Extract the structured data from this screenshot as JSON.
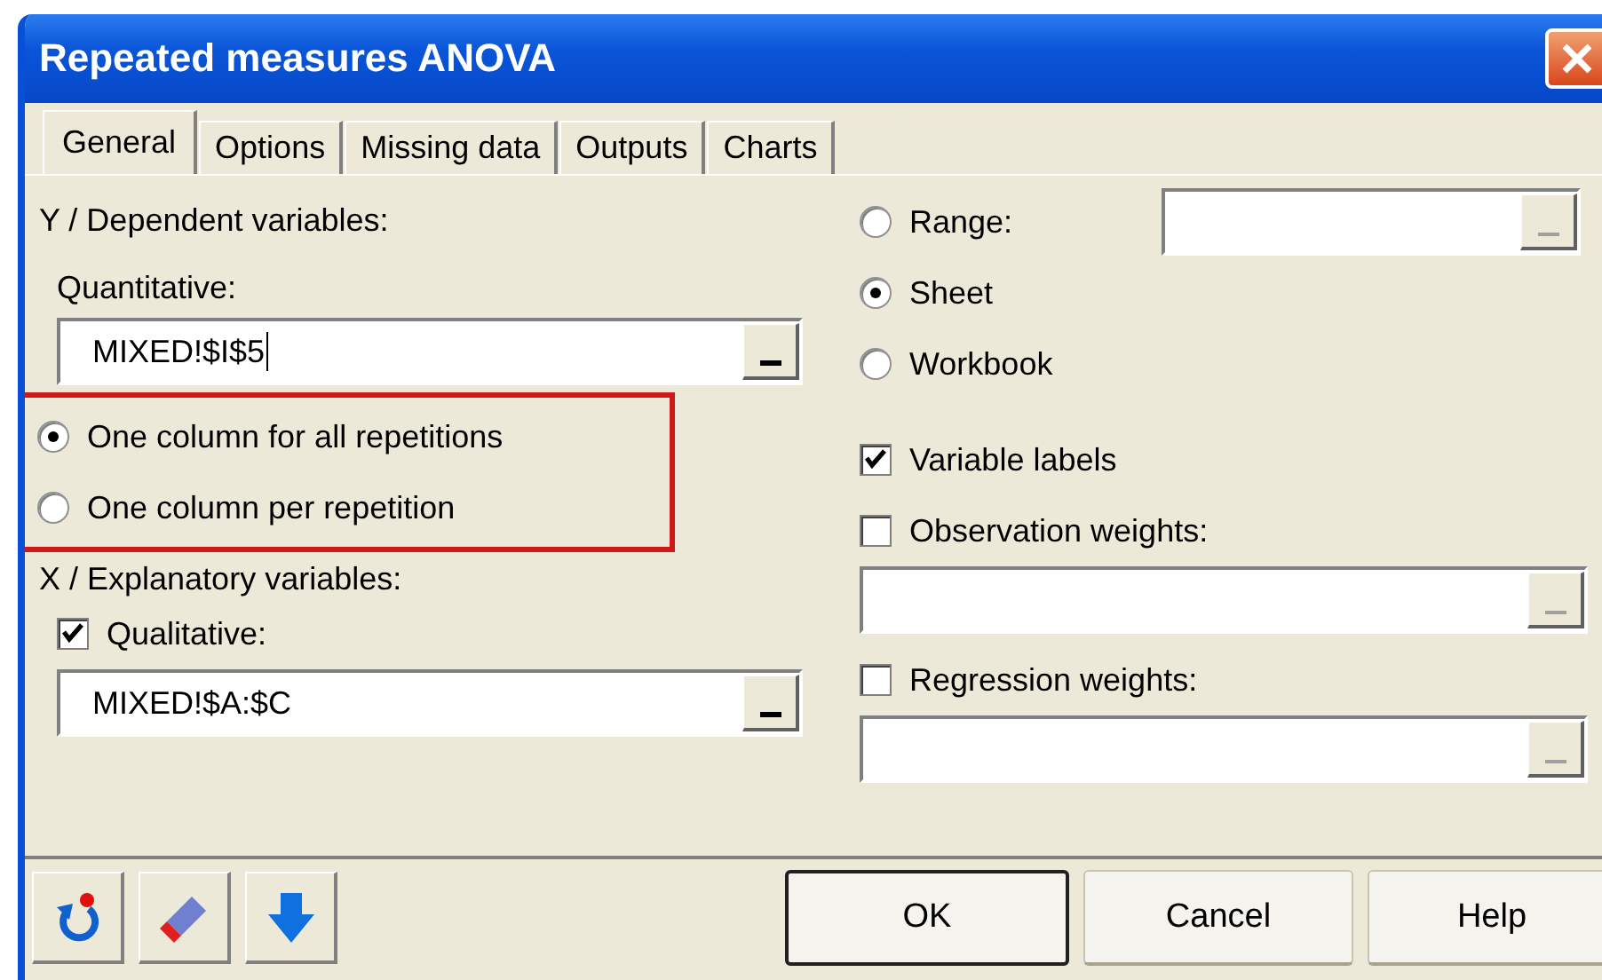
{
  "window": {
    "title": "Repeated measures ANOVA"
  },
  "tabs": [
    {
      "label": "General",
      "selected": true
    },
    {
      "label": "Options",
      "selected": false
    },
    {
      "label": "Missing data",
      "selected": false
    },
    {
      "label": "Outputs",
      "selected": false
    },
    {
      "label": "Charts",
      "selected": false
    }
  ],
  "dependent": {
    "heading": "Y / Dependent variables:",
    "label": "Quantitative:",
    "field": {
      "value": "MIXED!$I$5",
      "focused": true
    }
  },
  "repetition_layout": {
    "highlighted": true,
    "options": [
      {
        "label": "One column for all repetitions",
        "selected": true
      },
      {
        "label": "One column per repetition",
        "selected": false
      }
    ]
  },
  "explanatory": {
    "heading": "X / Explanatory variables:",
    "qualitative": {
      "label": "Qualitative:",
      "checked": true
    },
    "field": {
      "value": "MIXED!$A:$C"
    }
  },
  "output_scope": [
    {
      "label": "Range:",
      "selected": false,
      "has_field": true
    },
    {
      "label": "Sheet",
      "selected": true,
      "has_field": false
    },
    {
      "label": "Workbook",
      "selected": false,
      "has_field": false
    }
  ],
  "options": [
    {
      "label": "Variable labels",
      "checked": true,
      "has_field": false
    },
    {
      "label": "Observation weights:",
      "checked": false,
      "has_field": true
    },
    {
      "label": "Regression weights:",
      "checked": false,
      "has_field": true
    }
  ],
  "tool_buttons": [
    {
      "kind": "reset"
    },
    {
      "kind": "eraser"
    },
    {
      "kind": "down"
    }
  ],
  "buttons": [
    {
      "label": "OK",
      "default": true
    },
    {
      "label": "Cancel",
      "default": false
    },
    {
      "label": "Help",
      "default": false
    }
  ]
}
